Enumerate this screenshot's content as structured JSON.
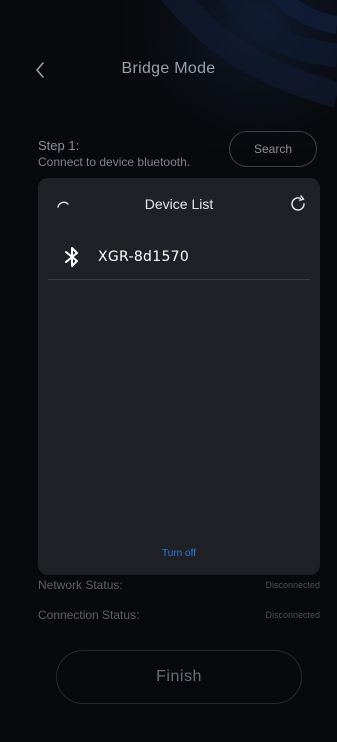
{
  "header": {
    "title": "Bridge Mode",
    "back_icon": "chevron-left-icon"
  },
  "step": {
    "title": "Step 1:",
    "description": "Connect to device bluetooth.",
    "search_label": "Search"
  },
  "dialog": {
    "title": "Device List",
    "loading_icon": "spinner-icon",
    "refresh_icon": "refresh-icon",
    "devices": [
      {
        "name": "XGR-8d1570",
        "icon": "bluetooth-icon"
      }
    ],
    "turn_off_label": "Turn off"
  },
  "status": {
    "network_label": "Network Status:",
    "network_value": "Disconnected",
    "connection_label": "Connection Status:",
    "connection_value": "Disconnected"
  },
  "finish_label": "Finish",
  "colors": {
    "background": "#08090c",
    "dialog_bg": "#202127",
    "accent_link": "#2f7ad8"
  }
}
